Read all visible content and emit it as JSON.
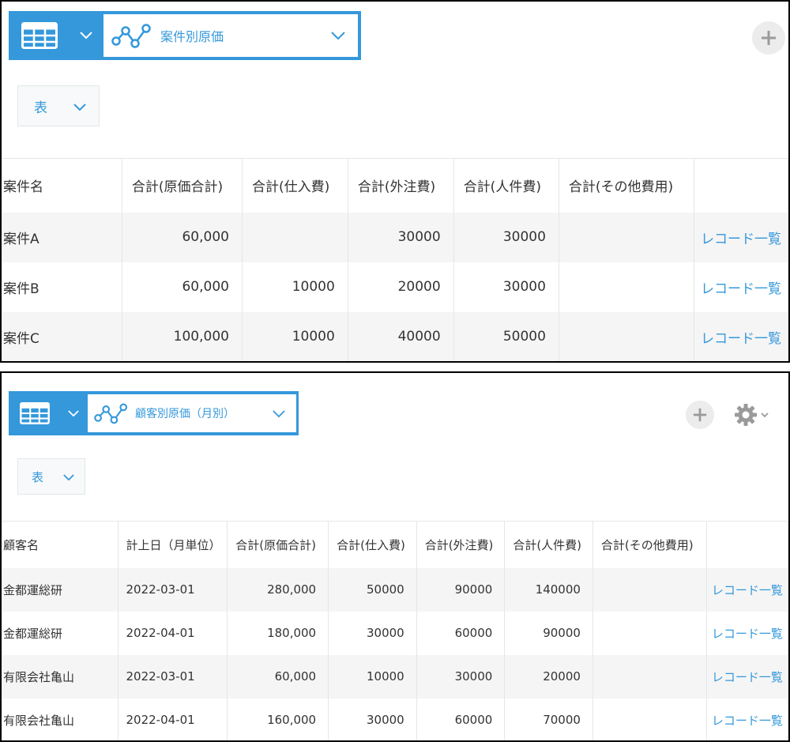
{
  "panel1": {
    "view_name": "案件別原価",
    "mode_label": "表",
    "columns": [
      "案件名",
      "合計(原価合計)",
      "合計(仕入費)",
      "合計(外注費)",
      "合計(人件費)",
      "合計(その他費用)",
      ""
    ],
    "rows": [
      {
        "name": "案件A",
        "total": "60,000",
        "purchase": "",
        "outsourcing": "30000",
        "labor": "30000",
        "other": "",
        "link": "レコード一覧"
      },
      {
        "name": "案件B",
        "total": "60,000",
        "purchase": "10000",
        "outsourcing": "20000",
        "labor": "30000",
        "other": "",
        "link": "レコード一覧"
      },
      {
        "name": "案件C",
        "total": "100,000",
        "purchase": "10000",
        "outsourcing": "40000",
        "labor": "50000",
        "other": "",
        "link": "レコード一覧"
      }
    ]
  },
  "panel2": {
    "view_name": "顧客別原価（月別）",
    "mode_label": "表",
    "columns": [
      "顧客名",
      "計上日（月単位）",
      "合計(原価合計)",
      "合計(仕入費)",
      "合計(外注費)",
      "合計(人件費)",
      "合計(その他費用)",
      ""
    ],
    "rows": [
      {
        "name": "金都運総研",
        "date": "2022-03-01",
        "total": "280,000",
        "purchase": "50000",
        "outsourcing": "90000",
        "labor": "140000",
        "other": "",
        "link": "レコード一覧"
      },
      {
        "name": "金都運総研",
        "date": "2022-04-01",
        "total": "180,000",
        "purchase": "30000",
        "outsourcing": "60000",
        "labor": "90000",
        "other": "",
        "link": "レコード一覧"
      },
      {
        "name": "有限会社亀山",
        "date": "2022-03-01",
        "total": "60,000",
        "purchase": "10000",
        "outsourcing": "30000",
        "labor": "20000",
        "other": "",
        "link": "レコード一覧"
      },
      {
        "name": "有限会社亀山",
        "date": "2022-04-01",
        "total": "160,000",
        "purchase": "30000",
        "outsourcing": "60000",
        "labor": "70000",
        "other": "",
        "link": "レコード一覧"
      }
    ]
  },
  "icons": {
    "view_type": "table-grid-icon",
    "graph": "line-graph-icon",
    "dropdown": "chevron-down-icon",
    "add": "plus-icon",
    "settings": "gear-icon"
  },
  "colors": {
    "accent": "#3498db",
    "row_stripe": "#f5f5f5",
    "plus_bg": "#ececec",
    "icon_gray": "#9a9a9a"
  }
}
